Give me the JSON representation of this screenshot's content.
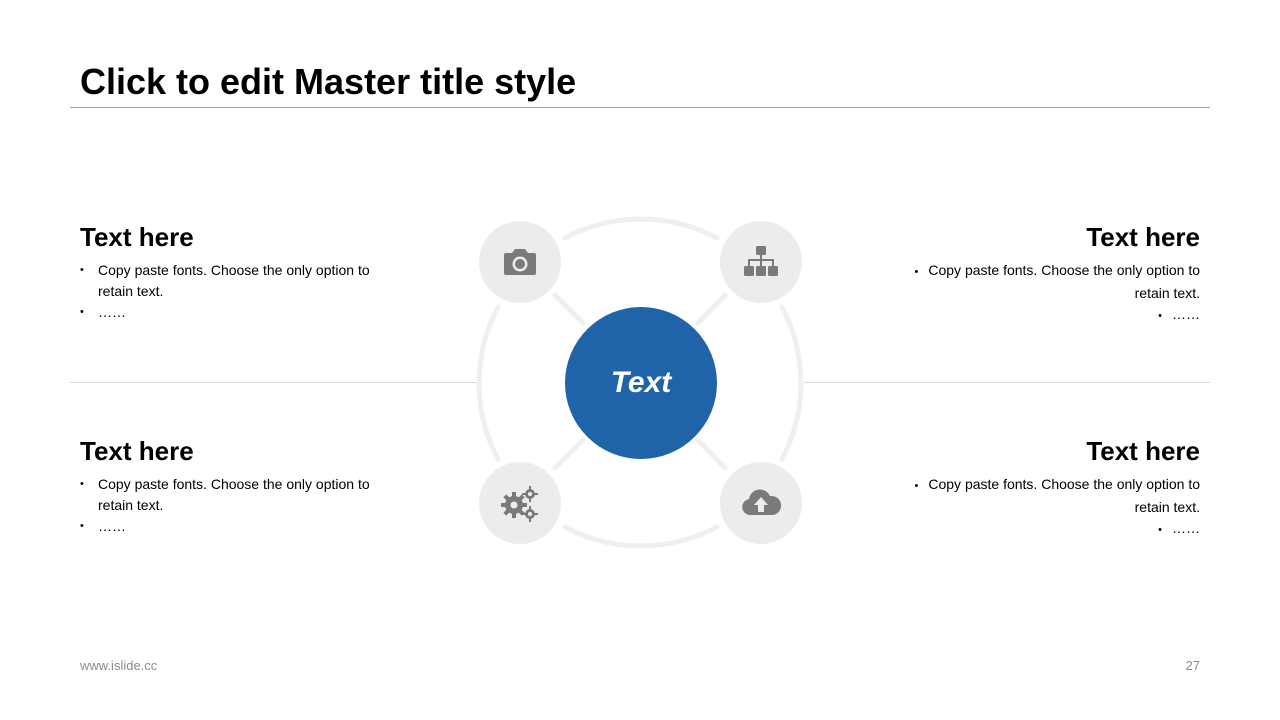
{
  "slide": {
    "title": "Click to edit Master title style"
  },
  "blocks": [
    {
      "heading": "Text here",
      "bullets": [
        "Copy paste fonts. Choose the only option to retain text.",
        "……"
      ]
    },
    {
      "heading": "Text here",
      "bullets": [
        "Copy paste fonts. Choose the only option to retain text.",
        "……"
      ]
    },
    {
      "heading": "Text here",
      "bullets": [
        "Copy paste fonts. Choose the only option to retain text.",
        "……"
      ]
    },
    {
      "heading": "Text here",
      "bullets": [
        "Copy paste fonts. Choose the only option to retain text.",
        "……"
      ]
    }
  ],
  "center": {
    "label": "Text"
  },
  "nodes": {
    "top_left": "camera-icon",
    "top_right": "sitemap-icon",
    "bottom_left": "gears-icon",
    "bottom_right": "cloud-upload-icon"
  },
  "colors": {
    "accent": "#1f63a8",
    "node_fill": "#ececec",
    "icon": "#7a7a7a",
    "ring": "#efefef"
  },
  "footer": {
    "url": "www.islide.cc",
    "page_number": "27"
  }
}
